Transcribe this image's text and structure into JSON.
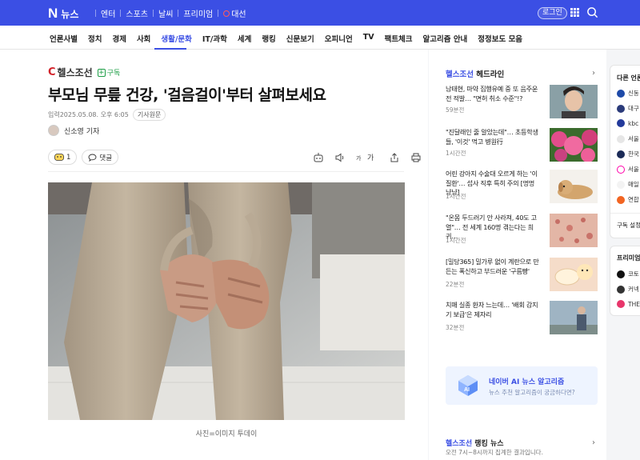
{
  "topbar": {
    "logo_letter": "N",
    "logo_text": "뉴스",
    "nav": [
      "엔터",
      "스포츠",
      "날씨",
      "프리미엄"
    ],
    "election": "대선",
    "login": "로그인",
    "accent_color": "#3b4fe4"
  },
  "categories": [
    "언론사별",
    "정치",
    "경제",
    "사회",
    "생활/문화",
    "IT/과학",
    "세계",
    "랭킹",
    "신문보기",
    "오피니언",
    "TV",
    "팩트체크",
    "알고리즘 안내",
    "정정보도 모음"
  ],
  "active_category": "생활/문화",
  "article": {
    "press": "헬스조선",
    "subscribe": "구독",
    "title": "부모님 무릎 건강, '걸음걸이'부터 살펴보세요",
    "published": "입력2025.05.08. 오후 6:05",
    "original_label": "기사원문",
    "reporter": "신소영 기자",
    "reaction_count": "1",
    "comment_label": "댓글",
    "font_tool": "가",
    "caption": "사진=이미지 투데이"
  },
  "rail": {
    "press": "헬스조선",
    "title_suffix": "헤드라인",
    "items": [
      {
        "title": "남태현, 마약 집행유예 중 또 음주운전 적발… \"면허 취소 수준\"!?",
        "comments": "59분전"
      },
      {
        "title": "\"진달래인 줄 알았는데\"… 초등학생들, '이것' 먹고 병원行",
        "comments": "1시간전"
      },
      {
        "title": "어린 강아지 수술대 오르게 하는 '이 질환'… 섭사 직후 특히 주의 [멍멍냥냥]",
        "comments": "1시간전"
      },
      {
        "title": "\"온몸 두드러기 안 사라져, 40도 고열\"… 전 세계 160명 겪는다는 희귀…",
        "comments": "1시간전"
      },
      {
        "title": "[밀당365] 밀가루 없이 계란으로 만든는 폭신하고 부드러운 '구름빵'",
        "comments": "22분전"
      },
      {
        "title": "치매 실종 환자 느는데… '배회 감지기 보급'은 제자리",
        "comments": "32분전"
      }
    ],
    "ai_title": "네이버 AI 뉴스 알고리즘",
    "ai_sub": "뉴스 추천 알고리즘이 궁금하다면?",
    "ranking_title_suffix": "랭킹 뉴스",
    "ranking_sub": "오전 7시~8시까지 집계한 결과입니다."
  },
  "far_panel": {
    "title": "다른 언론사",
    "items": [
      "신동",
      "대구",
      "kbc",
      "서울",
      "한국",
      "서울",
      "매일",
      "연합"
    ],
    "footer": "구독 설정",
    "premium_title": "프리미엄",
    "premium_items": [
      "코토",
      "커넥",
      "THE"
    ]
  }
}
